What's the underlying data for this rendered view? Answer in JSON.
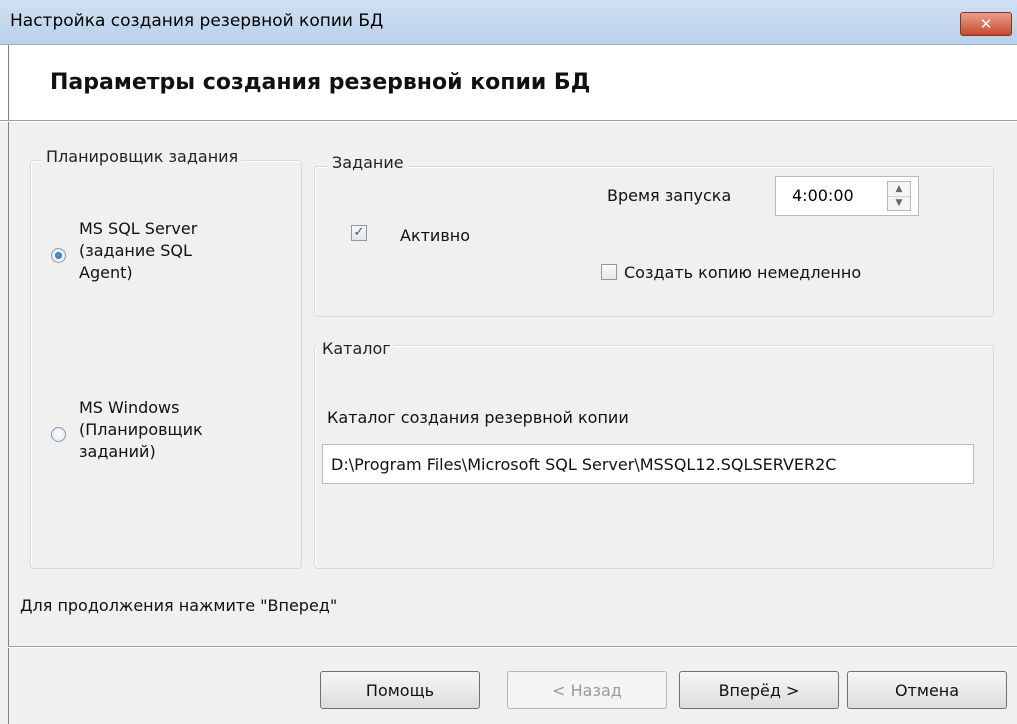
{
  "window": {
    "title": "Настройка создания резервной копии БД",
    "close_label": "✕"
  },
  "header": {
    "title": "Параметры создания резервной копии БД"
  },
  "scheduler": {
    "legend": "Планировщик задания",
    "options": [
      {
        "lines": [
          "MS SQL Server",
          "(задание SQL",
          "Agent)"
        ],
        "checked": true
      },
      {
        "lines": [
          "MS Windows",
          "(Планировщик",
          "заданий)"
        ],
        "checked": false
      }
    ]
  },
  "task": {
    "legend": "Задание",
    "active_label": "Активно",
    "active_checked": true,
    "start_time_label": "Время запуска",
    "start_time_value": "4:00:00",
    "backup_now_label": "Создать копию немедленно",
    "backup_now_checked": false
  },
  "catalog": {
    "legend": "Каталог",
    "path_label": "Каталог создания резервной копии",
    "path_value": "D:\\Program Files\\Microsoft SQL Server\\MSSQL12.SQLSERVER2C"
  },
  "status": {
    "hint": "Для продолжения нажмите \"Вперед\""
  },
  "buttons": {
    "help": "Помощь",
    "back": "< Назад",
    "next": "Вперёд >",
    "cancel": "Отмена"
  },
  "colors": {
    "titlebar": "#b9d1ea",
    "close_button": "#c84a2f",
    "dialog_bg": "#f0f0f0"
  }
}
